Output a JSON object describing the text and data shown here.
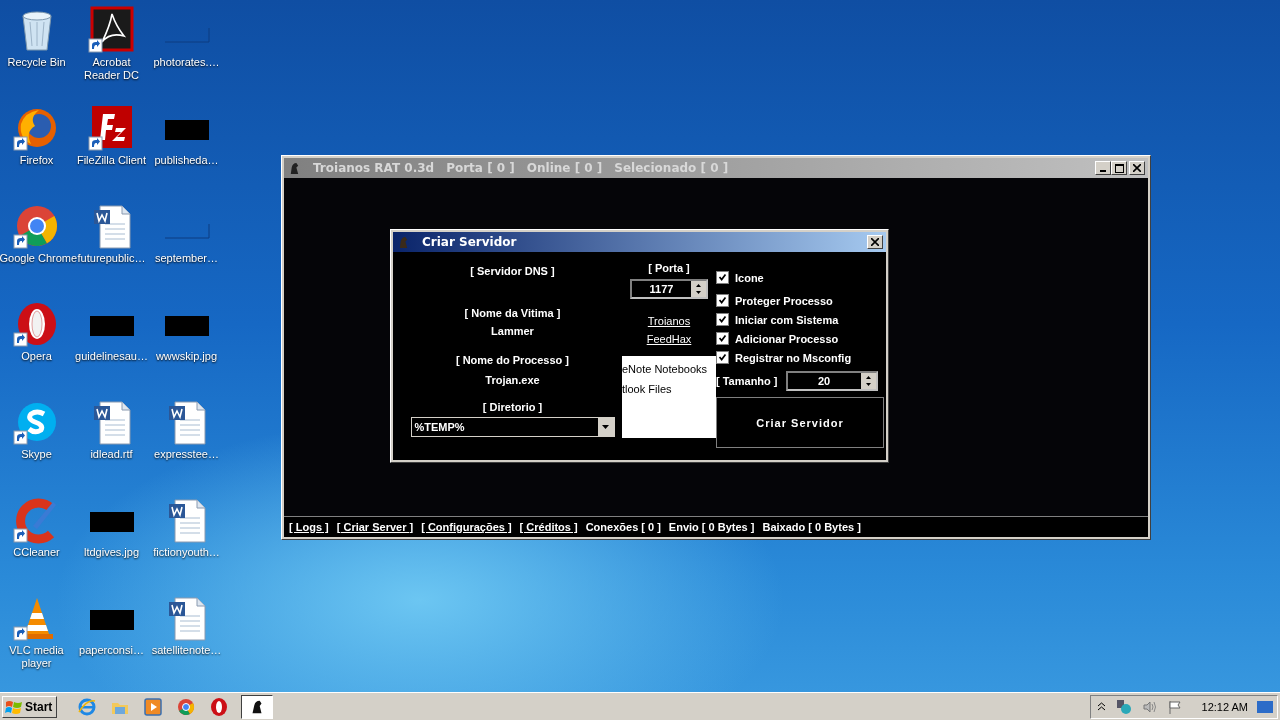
{
  "desktop_icons": [
    {
      "label": "Recycle Bin",
      "kind": "recycle",
      "shortcut": false
    },
    {
      "label": "Firefox",
      "kind": "firefox",
      "shortcut": true
    },
    {
      "label": "Google Chrome",
      "kind": "chrome",
      "shortcut": true
    },
    {
      "label": "Opera",
      "kind": "opera",
      "shortcut": true
    },
    {
      "label": "Skype",
      "kind": "skype",
      "shortcut": true
    },
    {
      "label": "CCleaner",
      "kind": "ccleaner",
      "shortcut": true
    },
    {
      "label": "VLC media player",
      "kind": "vlc",
      "shortcut": true
    },
    {
      "label": "Acrobat Reader DC",
      "kind": "acrobat",
      "shortcut": true
    },
    {
      "label": "FileZilla Client",
      "kind": "filezilla",
      "shortcut": true
    },
    {
      "label": "futurepublic…",
      "kind": "word",
      "shortcut": false
    },
    {
      "label": "guidelinesau…",
      "kind": "redacted",
      "shortcut": false
    },
    {
      "label": "idlead.rtf",
      "kind": "word",
      "shortcut": false
    },
    {
      "label": "ltdgives.jpg",
      "kind": "redacted",
      "shortcut": false
    },
    {
      "label": "paperconsi…",
      "kind": "redacted",
      "shortcut": false
    },
    {
      "label": "photorates.…",
      "kind": "blank",
      "shortcut": false
    },
    {
      "label": "publisheda…",
      "kind": "redacted",
      "shortcut": false
    },
    {
      "label": "september…",
      "kind": "blank",
      "shortcut": false
    },
    {
      "label": "wwwskip.jpg",
      "kind": "redacted",
      "shortcut": false
    },
    {
      "label": "expresstee…",
      "kind": "word",
      "shortcut": false
    },
    {
      "label": "fictionyouth…",
      "kind": "word",
      "shortcut": false
    },
    {
      "label": "satellitenote…",
      "kind": "word",
      "shortcut": false
    }
  ],
  "main_window": {
    "title": "Troianos RAT 0.3d",
    "active": false,
    "title_items": [
      "Porta [ 0 ]",
      "Online [ 0 ]",
      "Selecionado [ 0 ]"
    ],
    "status_links": [
      "[ Logs ]",
      "[ Criar Server ]",
      "[ Configurações ]",
      "[ Créditos ]"
    ],
    "status_texts": [
      "Conexões [ 0 ]",
      "Envio [ 0 Bytes ]",
      "Baixado [ 0 Bytes ]"
    ]
  },
  "dialog": {
    "title": "Criar Servidor",
    "servidor_dns_label": "[ Servidor DNS ]",
    "nome_vitima_label": "[ Nome da Vitima ]",
    "nome_vitima": "Lammer",
    "nome_processo_label": "[ Nome do Processo ]",
    "nome_processo": "Trojan.exe",
    "diretorio_label": "[ Diretorio ]",
    "diretorio": "%TEMP%",
    "porta_label": "[ Porta ]",
    "porta": "1177",
    "links": [
      "Troianos",
      "FeedHax"
    ],
    "popup_items": [
      "eNote Notebooks",
      "tlook Files"
    ],
    "checkboxes": [
      {
        "label": "Icone",
        "checked": true
      },
      {
        "label": "Proteger Processo",
        "checked": true
      },
      {
        "label": "Iniciar com Sistema",
        "checked": true
      },
      {
        "label": "Adicionar Processo",
        "checked": true
      },
      {
        "label": "Registrar no Msconfig",
        "checked": true
      }
    ],
    "tamanho_label": "[ Tamanho ]",
    "tamanho": "20",
    "button": "Criar Servidor"
  },
  "taskbar": {
    "start": "Start",
    "quick_launch": [
      {
        "kind": "ie"
      },
      {
        "kind": "folder"
      },
      {
        "kind": "media"
      },
      {
        "kind": "chrome"
      },
      {
        "kind": "opera"
      }
    ],
    "tasks": [
      {
        "kind": "rat",
        "selected": true
      }
    ],
    "clock": "12:12 AM"
  }
}
